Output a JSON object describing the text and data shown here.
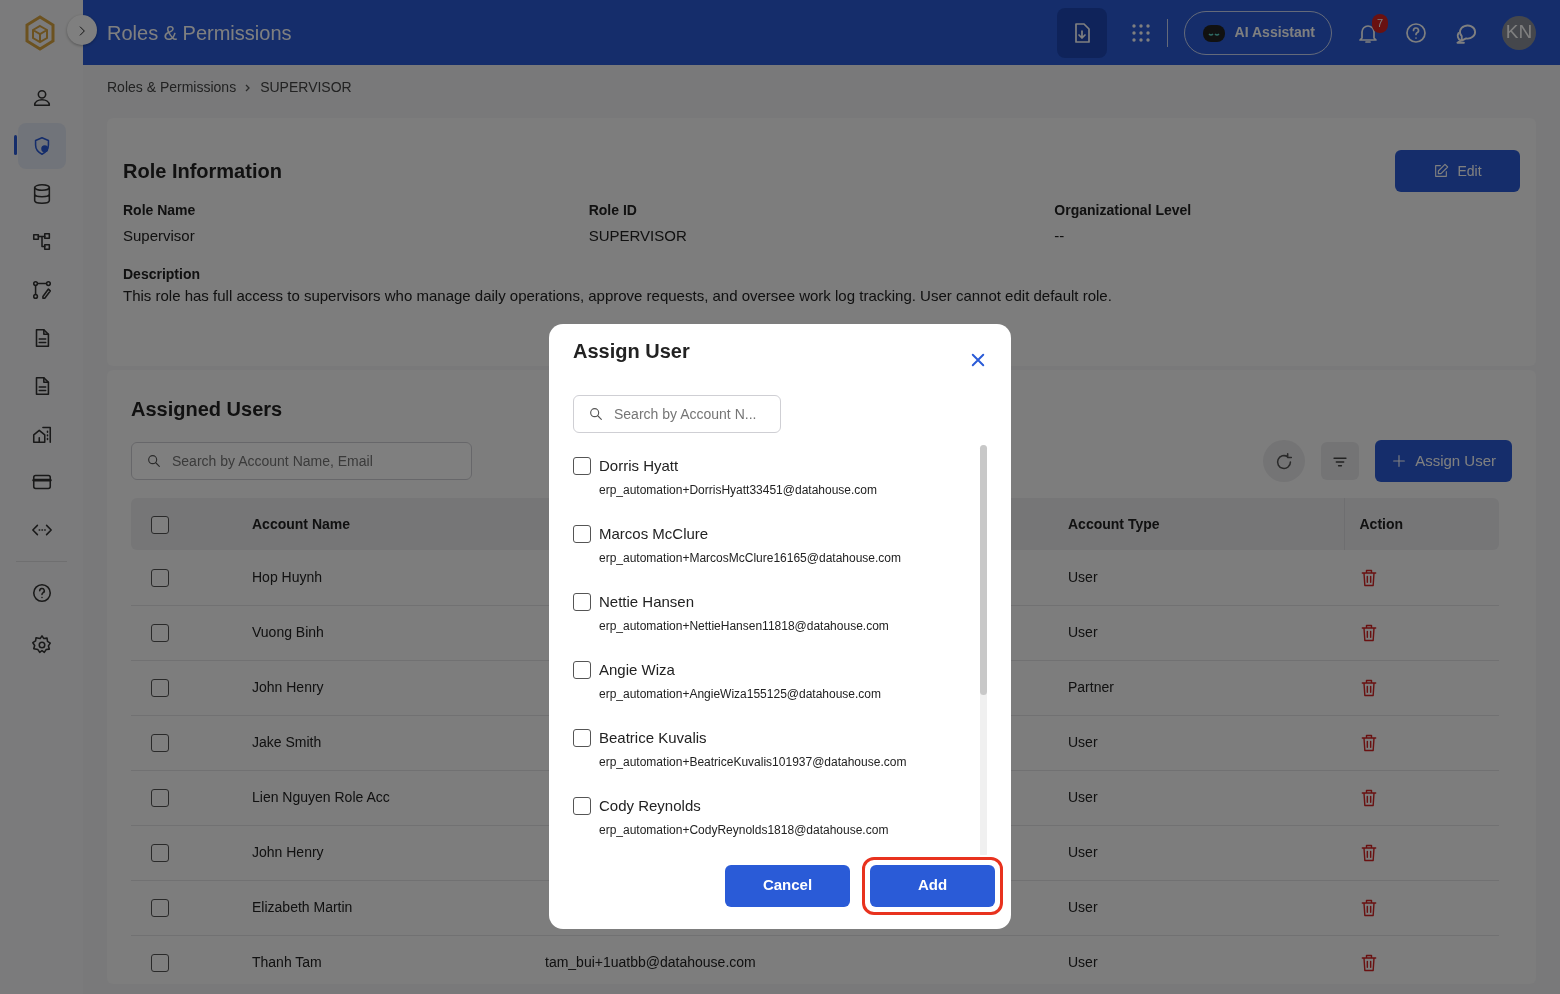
{
  "header": {
    "title": "Roles & Permissions",
    "ai_button": "AI Assistant",
    "notification_count": "7",
    "avatar": "KN"
  },
  "sidebar": {
    "items": [
      {
        "selected": false
      },
      {
        "selected": true
      },
      {
        "selected": false
      },
      {
        "selected": false
      },
      {
        "selected": false
      },
      {
        "selected": false
      },
      {
        "selected": false
      },
      {
        "selected": false
      },
      {
        "selected": false
      },
      {
        "selected": false
      }
    ],
    "bottom_items": [
      {
        "selected": false
      },
      {
        "selected": false
      }
    ]
  },
  "breadcrumb": [
    "Roles & Permissions",
    "SUPERVISOR"
  ],
  "role_info": {
    "title": "Role Information",
    "edit_button": "Edit",
    "fields": [
      {
        "label": "Role Name",
        "value": "Supervisor"
      },
      {
        "label": "Role ID",
        "value": "SUPERVISOR"
      },
      {
        "label": "Organizational Level",
        "value": "--"
      }
    ],
    "description_label": "Description",
    "description": "This role has full access to supervisors who manage daily operations, approve requests, and oversee work log tracking. User cannot edit default role."
  },
  "assigned_users": {
    "title": "Assigned Users",
    "search": {
      "placeholder": "Search by Account Name, Email"
    },
    "assign_button": "Assign User",
    "select_all_checked": false,
    "columns": [
      "Account Name",
      "Account Type",
      "Action"
    ],
    "rows": [
      {
        "name": "Hop Huynh",
        "type": "User",
        "checked": false
      },
      {
        "name": "Vuong Binh",
        "type": "User",
        "checked": false
      },
      {
        "name": "John Henry",
        "type": "Partner",
        "checked": false
      },
      {
        "name": "Jake Smith",
        "type": "User",
        "checked": false
      },
      {
        "name": "Lien Nguyen Role Acc",
        "type": "User",
        "checked": false
      },
      {
        "name": "John Henry",
        "type": "User",
        "checked": false
      },
      {
        "name": "Elizabeth Martin",
        "type": "User",
        "checked": false
      },
      {
        "name": "Thanh Tam",
        "email": "tam_bui+1uatbb@datahouse.com",
        "type": "User",
        "checked": false
      }
    ]
  },
  "modal": {
    "title": "Assign User",
    "search": {
      "placeholder": "Search by Account N..."
    },
    "users": [
      {
        "name": "Dorris Hyatt",
        "email": "erp_automation+DorrisHyatt33451@datahouse.com",
        "checked": false
      },
      {
        "name": "Marcos McClure",
        "email": "erp_automation+MarcosMcClure16165@datahouse.com",
        "checked": false
      },
      {
        "name": "Nettie Hansen",
        "email": "erp_automation+NettieHansen11818@datahouse.com",
        "checked": false
      },
      {
        "name": "Angie Wiza",
        "email": "erp_automation+AngieWiza155125@datahouse.com",
        "checked": false
      },
      {
        "name": "Beatrice Kuvalis",
        "email": "erp_automation+BeatriceKuvalis101937@datahouse.com",
        "checked": false
      },
      {
        "name": "Cody Reynolds",
        "email": "erp_automation+CodyReynolds1818@datahouse.com",
        "checked": false
      }
    ],
    "buttons": [
      {
        "label": "Cancel",
        "highlighted": false
      },
      {
        "label": "Add",
        "highlighted": true
      }
    ]
  }
}
